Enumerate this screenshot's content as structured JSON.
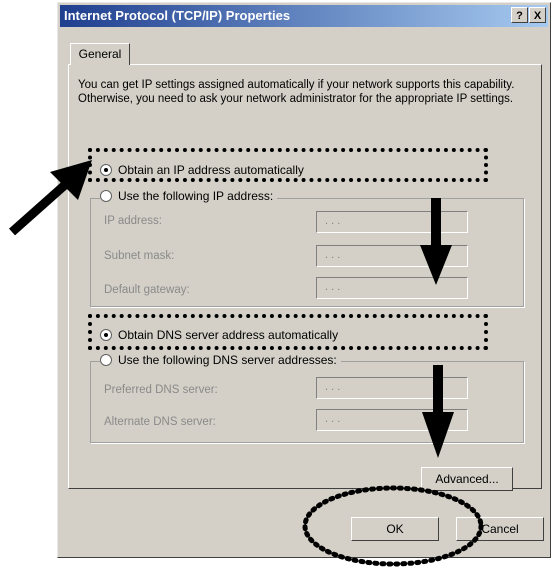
{
  "window": {
    "title": "Internet Protocol (TCP/IP) Properties",
    "help_button": "?",
    "close_button": "X"
  },
  "tabs": [
    {
      "label": "General"
    }
  ],
  "intro_text": "You can get IP settings assigned automatically if your network supports this capability. Otherwise, you need to ask your network administrator for the appropriate IP settings.",
  "ip_section": {
    "auto_label": "Obtain an IP address automatically",
    "auto_selected": true,
    "manual_label": "Use the following IP address:",
    "fields": [
      {
        "label": "IP address:",
        "value": ". . ."
      },
      {
        "label": "Subnet mask:",
        "value": ". . ."
      },
      {
        "label": "Default gateway:",
        "value": ". . ."
      }
    ]
  },
  "dns_section": {
    "auto_label": "Obtain DNS server address automatically",
    "auto_selected": true,
    "manual_label": "Use the following DNS server addresses:",
    "fields": [
      {
        "label": "Preferred DNS server:",
        "value": ". . ."
      },
      {
        "label": "Alternate DNS server:",
        "value": ". . ."
      }
    ]
  },
  "buttons": {
    "advanced": "Advanced...",
    "ok": "OK",
    "cancel": "Cancel"
  },
  "annotation_icons": [
    "arrow-right-icon",
    "arrow-down-icon",
    "dotted-highlight"
  ]
}
